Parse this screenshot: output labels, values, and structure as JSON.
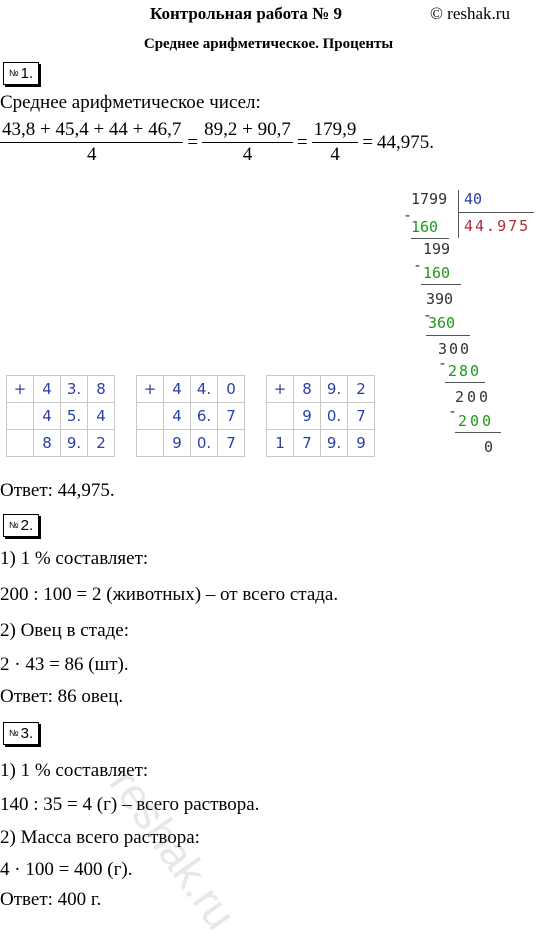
{
  "header": {
    "title": "Контрольная работа № 9",
    "site": "© reshak.ru",
    "subtitle": "Среднее арифметическое. Проценты"
  },
  "task1": {
    "badge_no": "№",
    "badge_num": "1.",
    "intro": "Среднее арифметическое чисел:",
    "frac1_num": "43,8 + 45,4 + 44 + 46,7",
    "frac1_den": "4",
    "eq": "=",
    "frac2_num": "89,2 + 90,7",
    "frac2_den": "4",
    "frac3_num": "179,9",
    "frac3_den": "4",
    "result": "44,975.",
    "division": {
      "dividend": "1799",
      "divisor": "40",
      "quotient": "44.975",
      "steps": [
        "160",
        "199",
        "160",
        "390",
        "360",
        "300",
        "280",
        "200",
        "200",
        "0"
      ]
    },
    "additions": [
      {
        "sign": "+",
        "row1": [
          "",
          "4",
          "3.",
          "8"
        ],
        "row2": [
          "",
          "4",
          "5.",
          "4"
        ],
        "sum": [
          "",
          "8",
          "9.",
          "2"
        ]
      },
      {
        "sign": "+",
        "row1": [
          "",
          "4",
          "4.",
          "0"
        ],
        "row2": [
          "",
          "4",
          "6.",
          "7"
        ],
        "sum": [
          "",
          "9",
          "0.",
          "7"
        ]
      },
      {
        "sign": "+",
        "row1": [
          "",
          "8",
          "9.",
          "2"
        ],
        "row2": [
          "",
          "9",
          "0.",
          "7"
        ],
        "sum": [
          "1",
          "7",
          "9.",
          "9"
        ]
      }
    ],
    "answer": "Ответ: 44,975."
  },
  "task2": {
    "badge_no": "№",
    "badge_num": "2.",
    "l1": "1) 1 % составляет:",
    "l2": "200 : 100 = 2 (животных) – от всего стада.",
    "l3": "2) Овец в стаде:",
    "l4": "2 · 43 = 86 (шт).",
    "answer": "Ответ: 86 овец."
  },
  "task3": {
    "badge_no": "№",
    "badge_num": "3.",
    "l1": "1) 1 % составляет:",
    "l2": "140 : 35 = 4 (г) – всего раствора.",
    "l3": "2) Масса всего раствора:",
    "l4": "4 · 100 = 400 (г).",
    "answer": "Ответ: 400 г."
  },
  "watermark": "reshak.ru"
}
